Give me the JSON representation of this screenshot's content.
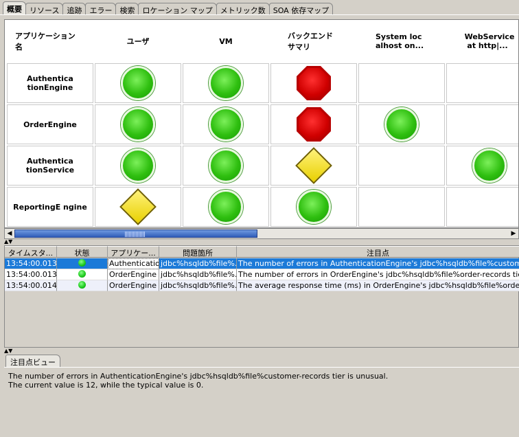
{
  "tabs": [
    "概要",
    "リソース",
    "追跡",
    "エラー",
    "検索",
    "ロケーション マップ",
    "メトリック数",
    "SOA 依存マップ"
  ],
  "grid": {
    "headers": [
      "アプリケーション\n名",
      "ユーザ",
      "VM",
      "バックエンド\nサマリ",
      "System loc\nalhost on...",
      "WebService\n at http|..."
    ],
    "rows": [
      {
        "name": "Authentica tionEngine",
        "status": [
          "green",
          "green",
          "red",
          "",
          ""
        ]
      },
      {
        "name": "OrderEngine",
        "status": [
          "green",
          "green",
          "red",
          "green",
          ""
        ]
      },
      {
        "name": "Authentica tionService",
        "status": [
          "green",
          "green",
          "yellow",
          "",
          "green"
        ]
      },
      {
        "name": "ReportingE ngine",
        "status": [
          "yellow",
          "green",
          "green",
          "",
          ""
        ]
      }
    ]
  },
  "events": {
    "columns": [
      "タイムスタ...",
      "状態",
      "アプリケー...",
      "問題箇所",
      "注目点"
    ],
    "rows": [
      {
        "time": "13:54:00.013...",
        "app": "Authenticatio...",
        "location": "jdbc%hsqldb%file%...",
        "note": "The number of errors in AuthenticationEngine's jdbc%hsqldb%file%customer-recor..."
      },
      {
        "time": "13:54:00.013...",
        "app": "OrderEngine",
        "location": "jdbc%hsqldb%file%...",
        "note": "The number of errors in OrderEngine's jdbc%hsqldb%file%order-records tier is un..."
      },
      {
        "time": "13:54:00.014...",
        "app": "OrderEngine",
        "location": "jdbc%hsqldb%file%...",
        "note": "The average response time (ms) in OrderEngine's jdbc%hsqldb%file%order-record..."
      }
    ]
  },
  "detail": {
    "tab": "注目点ビュー",
    "line1": "The number of errors in AuthenticationEngine's jdbc%hsqldb%file%customer-records tier is unusual.",
    "line2": "The current value is 12, while the typical value is 0."
  }
}
